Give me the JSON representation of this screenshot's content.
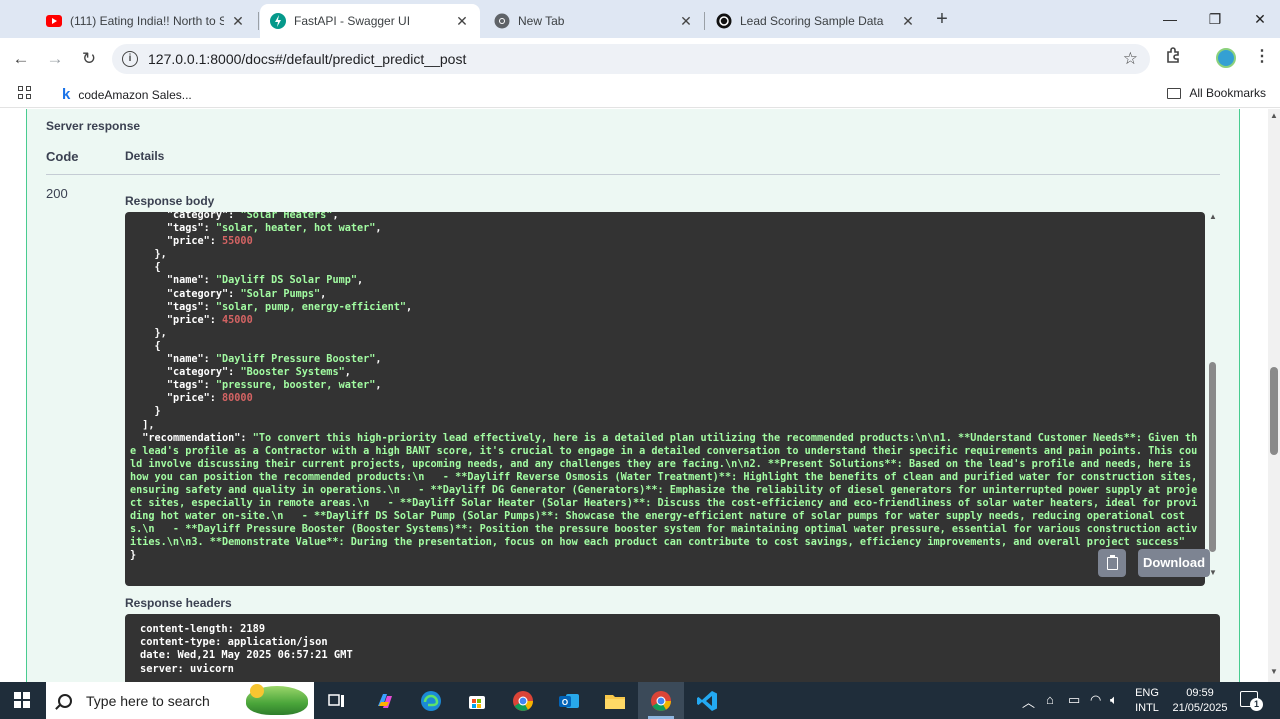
{
  "browser": {
    "tabs": [
      {
        "title": "(111) Eating India!! North to So",
        "icon": "youtube-icon",
        "active": false
      },
      {
        "title": "FastAPI - Swagger UI",
        "icon": "fastapi-icon",
        "active": true
      },
      {
        "title": "New Tab",
        "icon": "chrome-icon",
        "active": false
      },
      {
        "title": "Lead Scoring Sample Data",
        "icon": "openai-icon",
        "active": false
      }
    ],
    "new_tab": "+",
    "url": "127.0.0.1:8000/docs#/default/predict_predict__post",
    "bookmarks": [
      {
        "label": "codeAmazon Sales..."
      }
    ],
    "all_bookmarks": "All Bookmarks"
  },
  "swagger": {
    "server_response": "Server response",
    "col_code": "Code",
    "col_details": "Details",
    "status_code": "200",
    "response_body_label": "Response body",
    "response_body_lines": [
      [
        [
          "      ",
          ""
        ],
        [
          "\"category\"",
          "key"
        ],
        [
          ": ",
          ""
        ],
        [
          "\"Solar Heaters\"",
          "str"
        ],
        [
          ",",
          ""
        ]
      ],
      [
        [
          "      ",
          ""
        ],
        [
          "\"tags\"",
          "key"
        ],
        [
          ": ",
          ""
        ],
        [
          "\"solar, heater, hot water\"",
          "str"
        ],
        [
          ",",
          ""
        ]
      ],
      [
        [
          "      ",
          ""
        ],
        [
          "\"price\"",
          "key"
        ],
        [
          ": ",
          ""
        ],
        [
          "55000",
          "num"
        ]
      ],
      [
        [
          "    },",
          ""
        ]
      ],
      [
        [
          "    {",
          ""
        ]
      ],
      [
        [
          "      ",
          ""
        ],
        [
          "\"name\"",
          "key"
        ],
        [
          ": ",
          ""
        ],
        [
          "\"Dayliff DS Solar Pump\"",
          "str"
        ],
        [
          ",",
          ""
        ]
      ],
      [
        [
          "      ",
          ""
        ],
        [
          "\"category\"",
          "key"
        ],
        [
          ": ",
          ""
        ],
        [
          "\"Solar Pumps\"",
          "str"
        ],
        [
          ",",
          ""
        ]
      ],
      [
        [
          "      ",
          ""
        ],
        [
          "\"tags\"",
          "key"
        ],
        [
          ": ",
          ""
        ],
        [
          "\"solar, pump, energy-efficient\"",
          "str"
        ],
        [
          ",",
          ""
        ]
      ],
      [
        [
          "      ",
          ""
        ],
        [
          "\"price\"",
          "key"
        ],
        [
          ": ",
          ""
        ],
        [
          "45000",
          "num"
        ]
      ],
      [
        [
          "    },",
          ""
        ]
      ],
      [
        [
          "    {",
          ""
        ]
      ],
      [
        [
          "      ",
          ""
        ],
        [
          "\"name\"",
          "key"
        ],
        [
          ": ",
          ""
        ],
        [
          "\"Dayliff Pressure Booster\"",
          "str"
        ],
        [
          ",",
          ""
        ]
      ],
      [
        [
          "      ",
          ""
        ],
        [
          "\"category\"",
          "key"
        ],
        [
          ": ",
          ""
        ],
        [
          "\"Booster Systems\"",
          "str"
        ],
        [
          ",",
          ""
        ]
      ],
      [
        [
          "      ",
          ""
        ],
        [
          "\"tags\"",
          "key"
        ],
        [
          ": ",
          ""
        ],
        [
          "\"pressure, booster, water\"",
          "str"
        ],
        [
          ",",
          ""
        ]
      ],
      [
        [
          "      ",
          ""
        ],
        [
          "\"price\"",
          "key"
        ],
        [
          ": ",
          ""
        ],
        [
          "80000",
          "num"
        ]
      ],
      [
        [
          "    }",
          ""
        ]
      ],
      [
        [
          "  ],",
          ""
        ]
      ],
      [
        [
          "  ",
          ""
        ],
        [
          "\"recommendation\"",
          "key"
        ],
        [
          ": ",
          ""
        ],
        [
          "\"To convert this high-priority lead effectively, here is a detailed plan utilizing the recommended products:\\n\\n1. **Understand Customer Needs**: Given the lead's profile as a Contractor with a high BANT score, it's crucial to engage in a detailed conversation to understand their specific requirements and pain points. This could involve discussing their current projects, upcoming needs, and any challenges they are facing.\\n\\n2. **Present Solutions**: Based on the lead's profile and needs, here is how you can position the recommended products:\\n   - **Dayliff Reverse Osmosis (Water Treatment)**: Highlight the benefits of clean and purified water for construction sites, ensuring safety and quality in operations.\\n   - **Dayliff DG Generator (Generators)**: Emphasize the reliability of diesel generators for uninterrupted power supply at project sites, especially in remote areas.\\n   - **Dayliff Solar Heater (Solar Heaters)**: Discuss the cost-efficiency and eco-friendliness of solar water heaters, ideal for providing hot water on-site.\\n   - **Dayliff DS Solar Pump (Solar Pumps)**: Showcase the energy-efficient nature of solar pumps for water supply needs, reducing operational costs.\\n   - **Dayliff Pressure Booster (Booster Systems)**: Position the pressure booster system for maintaining optimal water pressure, essential for various construction activities.\\n\\n3. **Demonstrate Value**: During the presentation, focus on how each product can contribute to cost savings, efficiency improvements, and overall project success\"",
          "str"
        ]
      ],
      [
        [
          "}",
          ""
        ]
      ]
    ],
    "download_label": "Download",
    "response_headers_label": "Response headers",
    "response_headers": [
      "content-length: 2189",
      "content-type: application/json",
      "date: Wed,21 May 2025 06:57:21 GMT",
      "server: uvicorn"
    ]
  },
  "taskbar": {
    "search_placeholder": "Type here to search",
    "apps": [
      "task-view-icon",
      "copilot-icon",
      "edge-icon",
      "store-icon",
      "chrome-icon",
      "outlook-icon",
      "file-explorer-icon",
      "chrome-active-icon",
      "vscode-icon"
    ],
    "language_line1": "ENG",
    "language_line2": "INTL",
    "time": "09:59",
    "date": "21/05/2025",
    "notification_count": "1"
  },
  "colors": {
    "json_string": "#a2fca2",
    "json_number": "#d36363",
    "opblock_border": "#49cc90",
    "opblock_bg": "#edf8f3",
    "code_bg": "#333333"
  }
}
